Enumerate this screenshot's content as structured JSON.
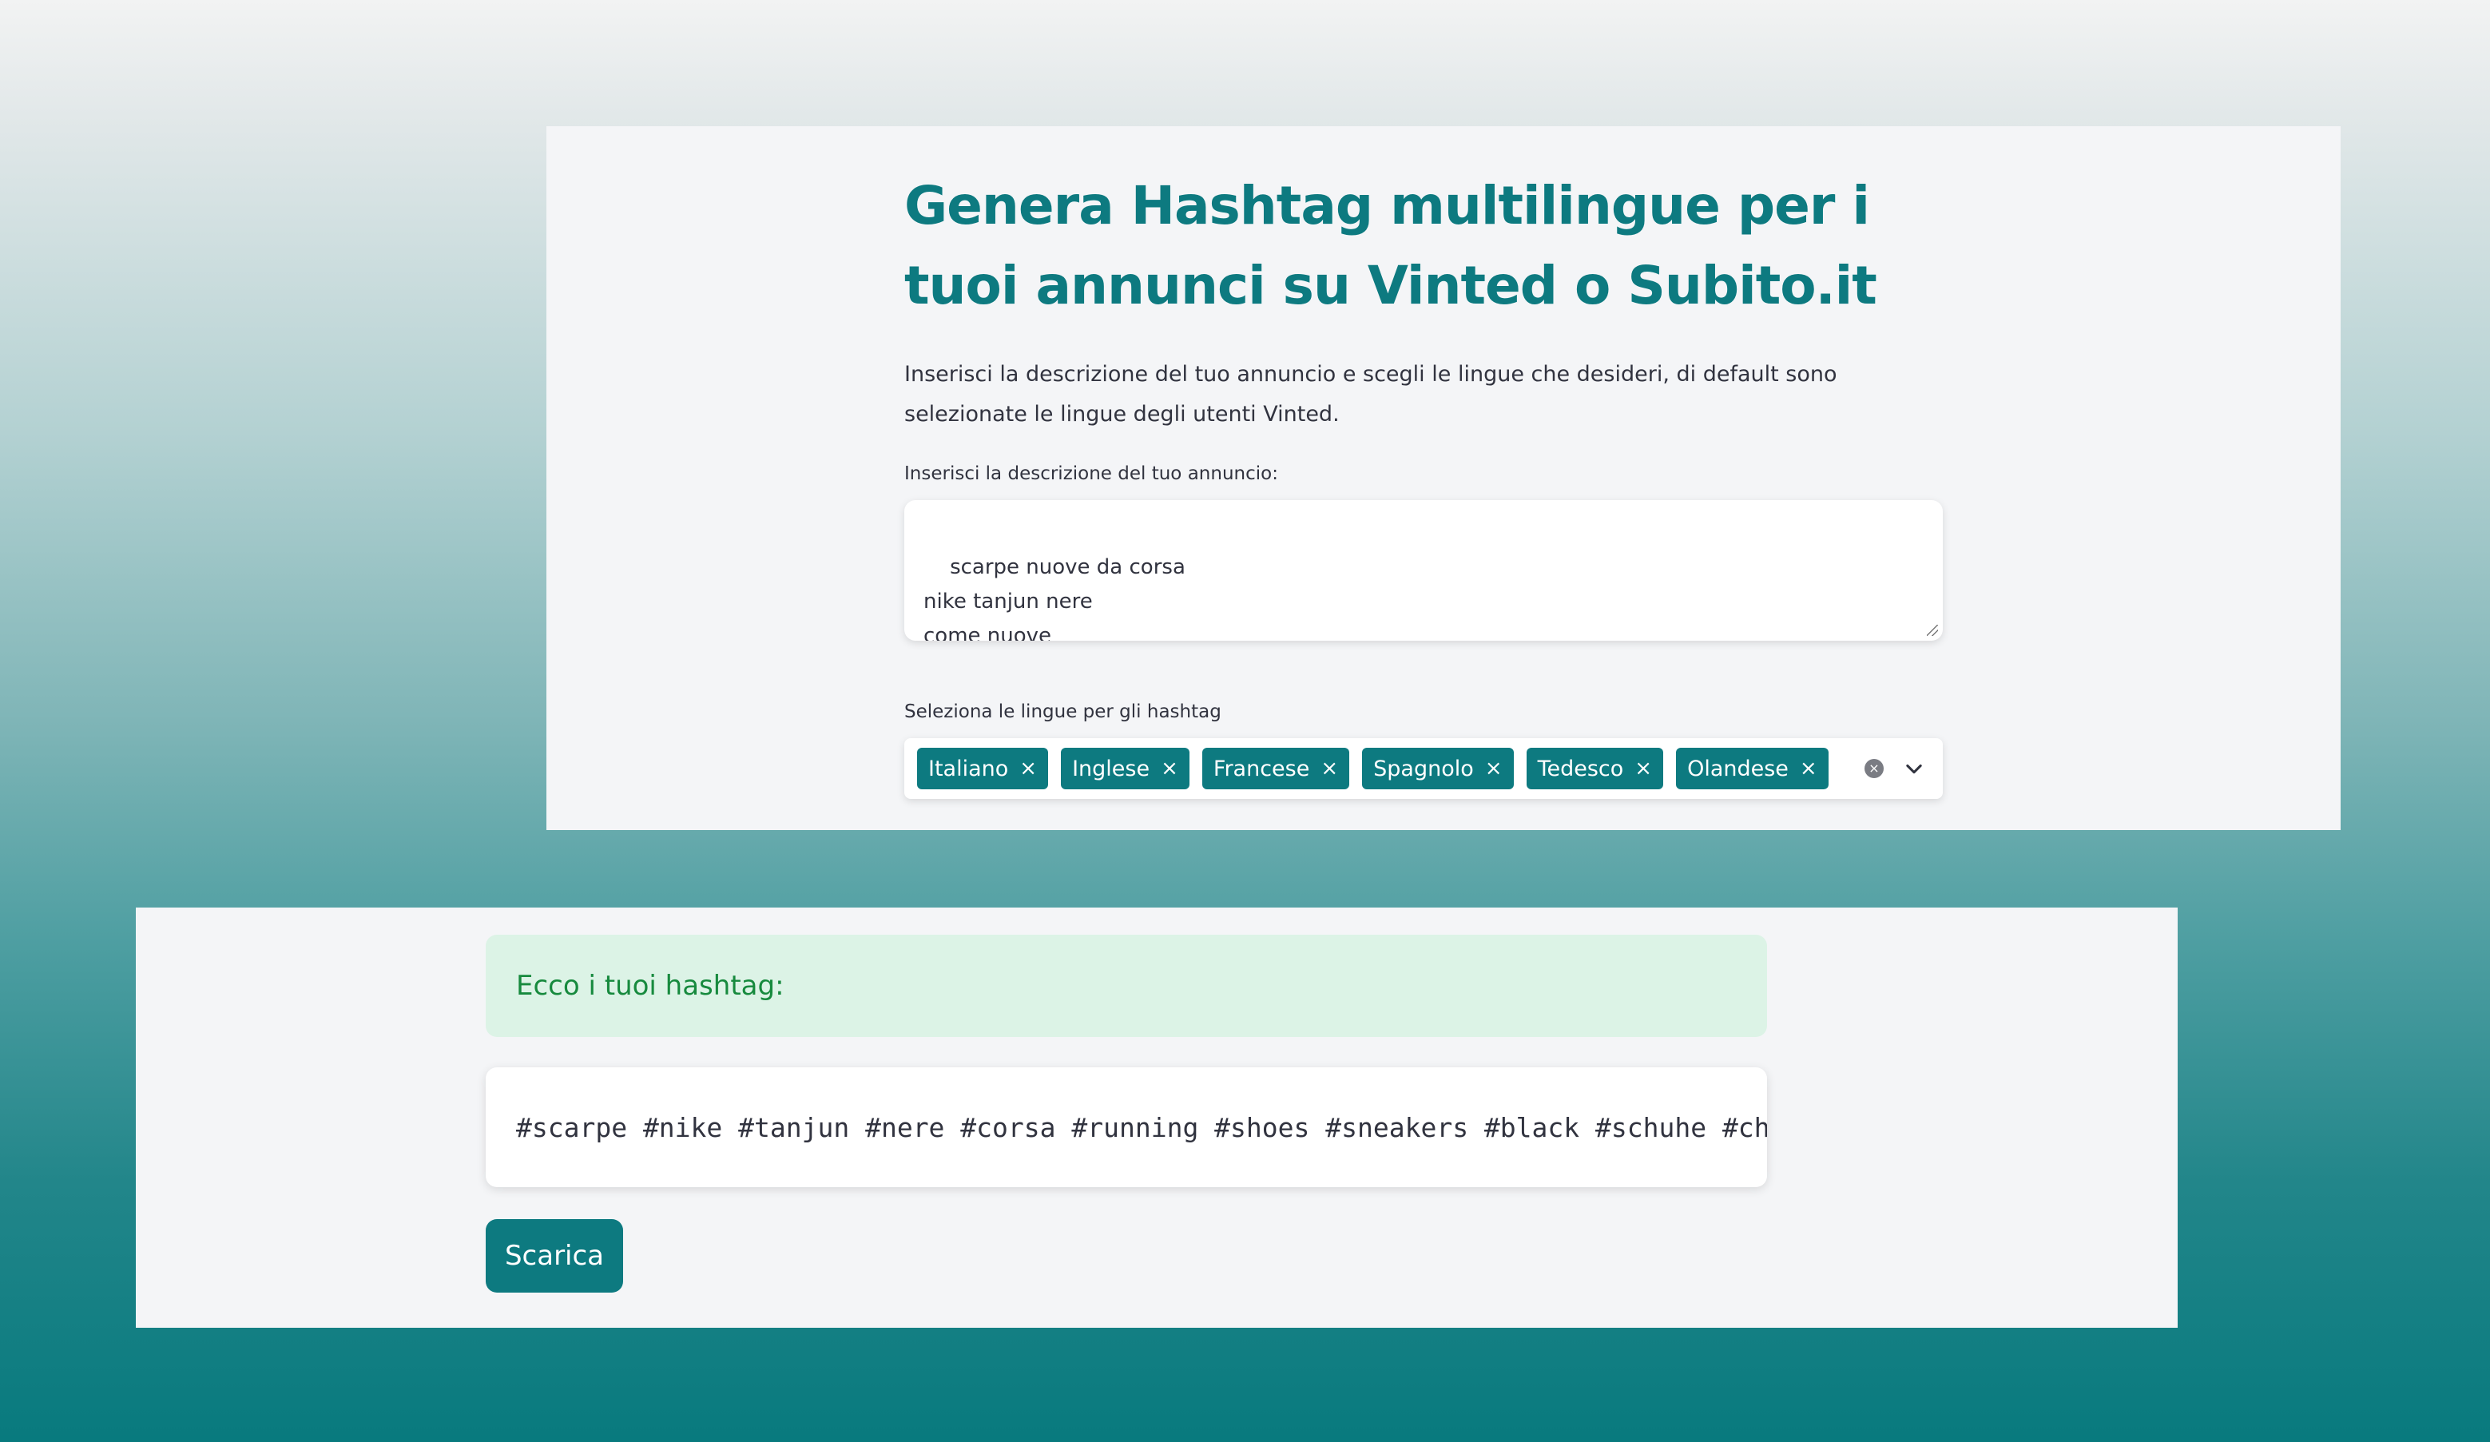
{
  "app": {
    "title": "Genera Hashtag multilingue per i tuoi annunci su Vinted o Subito.it",
    "intro": "Inserisci la descrizione del tuo annuncio e scegli le lingue che desideri, di default sono selezionate le lingue degli utenti Vinted."
  },
  "description_field": {
    "label": "Inserisci la descrizione del tuo annuncio:",
    "value": "scarpe nuove da corsa\nnike tanjun nere\ncome nuove"
  },
  "language_select": {
    "label": "Seleziona le lingue per gli hashtag",
    "selected": [
      "Italiano",
      "Inglese",
      "Francese",
      "Spagnolo",
      "Tedesco",
      "Olandese"
    ],
    "remove_glyph": "×",
    "clear_glyph": "×"
  },
  "result": {
    "success_message": "Ecco i tuoi hashtag:",
    "hashtags": "#scarpe #nike #tanjun #nere #corsa #running #shoes #sneakers #black #schuhe #chaussures",
    "download_label": "Scarica"
  },
  "colors": {
    "accent": "#0d7a80",
    "success_bg": "#dcf3e6",
    "success_text": "#178a3e"
  }
}
